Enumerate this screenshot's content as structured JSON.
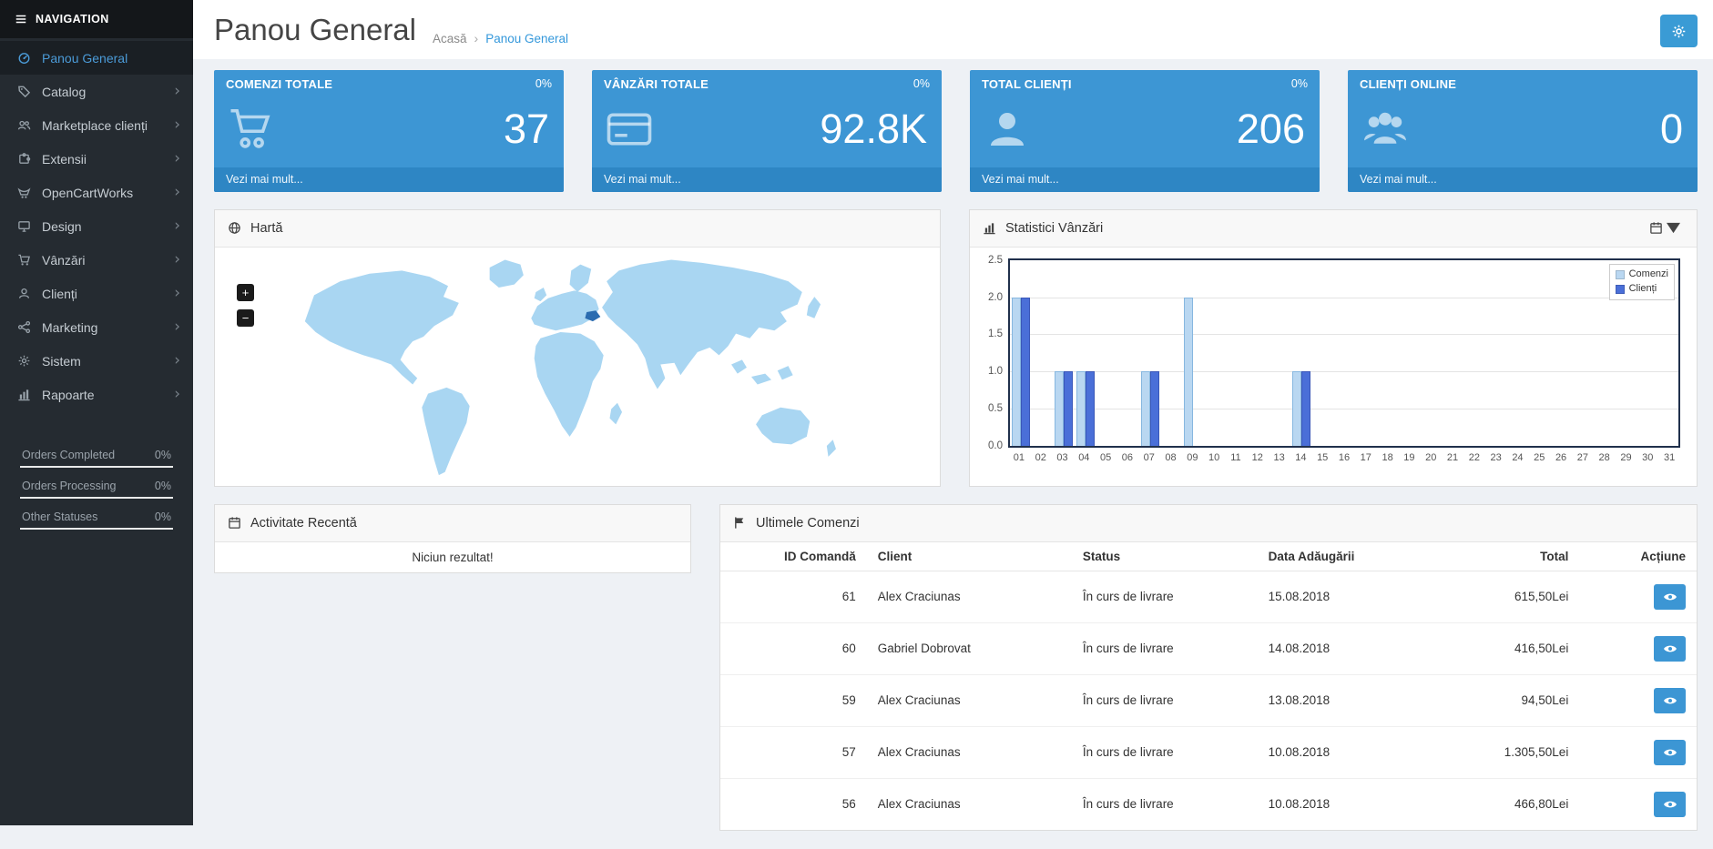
{
  "sidebar": {
    "nav_header": "NAVIGATION",
    "items": [
      {
        "label": "Panou General",
        "icon": "dashboard-icon",
        "active": true,
        "has_children": false
      },
      {
        "label": "Catalog",
        "icon": "tags-icon",
        "active": false,
        "has_children": true
      },
      {
        "label": "Marketplace clienți",
        "icon": "users-icon",
        "active": false,
        "has_children": true
      },
      {
        "label": "Extensii",
        "icon": "puzzle-icon",
        "active": false,
        "has_children": true
      },
      {
        "label": "OpenCartWorks",
        "icon": "opencart-icon",
        "active": false,
        "has_children": true
      },
      {
        "label": "Design",
        "icon": "monitor-icon",
        "active": false,
        "has_children": true
      },
      {
        "label": "Vânzări",
        "icon": "cart-icon",
        "active": false,
        "has_children": true
      },
      {
        "label": "Clienți",
        "icon": "user-icon",
        "active": false,
        "has_children": true
      },
      {
        "label": "Marketing",
        "icon": "share-icon",
        "active": false,
        "has_children": true
      },
      {
        "label": "Sistem",
        "icon": "gear-icon",
        "active": false,
        "has_children": true
      },
      {
        "label": "Rapoarte",
        "icon": "bar-chart-icon",
        "active": false,
        "has_children": true
      }
    ],
    "stats": [
      {
        "label": "Orders Completed",
        "value": "0%"
      },
      {
        "label": "Orders Processing",
        "value": "0%"
      },
      {
        "label": "Other Statuses",
        "value": "0%"
      }
    ]
  },
  "header": {
    "title": "Panou General",
    "breadcrumb": [
      "Acasă",
      "Panou General"
    ]
  },
  "tiles": [
    {
      "title": "COMENZI TOTALE",
      "percent": "0%",
      "value": "37",
      "icon": "shopping-cart-icon",
      "link": "Vezi mai mult..."
    },
    {
      "title": "VÂNZĂRI TOTALE",
      "percent": "0%",
      "value": "92.8K",
      "icon": "credit-card-icon",
      "link": "Vezi mai mult..."
    },
    {
      "title": "TOTAL CLIENȚI",
      "percent": "0%",
      "value": "206",
      "icon": "person-icon",
      "link": "Vezi mai mult..."
    },
    {
      "title": "CLIENȚI ONLINE",
      "percent": "",
      "value": "0",
      "icon": "people-icon",
      "link": "Vezi mai mult..."
    }
  ],
  "map_panel": {
    "title": "Hartă",
    "zoom_in": "+",
    "zoom_out": "−"
  },
  "chart_panel": {
    "title": "Statistici Vânzări"
  },
  "chart_data": {
    "type": "bar",
    "title": "Statistici Vânzări",
    "x": [
      "01",
      "02",
      "03",
      "04",
      "05",
      "06",
      "07",
      "08",
      "09",
      "10",
      "11",
      "12",
      "13",
      "14",
      "15",
      "16",
      "17",
      "18",
      "19",
      "20",
      "21",
      "22",
      "23",
      "24",
      "25",
      "26",
      "27",
      "28",
      "29",
      "30",
      "31"
    ],
    "series": [
      {
        "name": "Comenzi",
        "color": "#b9d7f1",
        "border": "#86b7e0",
        "values": [
          2,
          0,
          1,
          1,
          0,
          0,
          1,
          0,
          2,
          0,
          0,
          0,
          0,
          1,
          0,
          0,
          0,
          0,
          0,
          0,
          0,
          0,
          0,
          0,
          0,
          0,
          0,
          0,
          0,
          0,
          0
        ]
      },
      {
        "name": "Clienți",
        "color": "#4a6fd8",
        "border": "#3a57b8",
        "values": [
          2,
          0,
          1,
          1,
          0,
          0,
          1,
          0,
          0,
          0,
          0,
          0,
          0,
          1,
          0,
          0,
          0,
          0,
          0,
          0,
          0,
          0,
          0,
          0,
          0,
          0,
          0,
          0,
          0,
          0,
          0
        ]
      }
    ],
    "ylim": [
      0,
      2.5
    ],
    "yticks": [
      0.0,
      0.5,
      1.0,
      1.5,
      2.0,
      2.5
    ],
    "grid": true,
    "legend_position": "top-right"
  },
  "activity_panel": {
    "title": "Activitate Recentă",
    "empty_text": "Niciun rezultat!"
  },
  "orders_panel": {
    "title": "Ultimele Comenzi",
    "columns": [
      "ID Comandă",
      "Client",
      "Status",
      "Data Adăugării",
      "Total",
      "Acțiune"
    ],
    "rows": [
      {
        "id": "61",
        "client": "Alex Craciunas",
        "status": "În curs de livrare",
        "date": "15.08.2018",
        "total": "615,50Lei"
      },
      {
        "id": "60",
        "client": "Gabriel Dobrovat",
        "status": "În curs de livrare",
        "date": "14.08.2018",
        "total": "416,50Lei"
      },
      {
        "id": "59",
        "client": "Alex Craciunas",
        "status": "În curs de livrare",
        "date": "13.08.2018",
        "total": "94,50Lei"
      },
      {
        "id": "57",
        "client": "Alex Craciunas",
        "status": "În curs de livrare",
        "date": "10.08.2018",
        "total": "1.305,50Lei"
      },
      {
        "id": "56",
        "client": "Alex Craciunas",
        "status": "În curs de livrare",
        "date": "10.08.2018",
        "total": "466,80Lei"
      }
    ]
  },
  "colors": {
    "accent": "#3498db",
    "tile_bg": "#3d96d4",
    "tile_footer": "#2e86c4",
    "sidebar_bg": "#252b31",
    "sidebar_header_bg": "#14171a",
    "sidebar_active_text": "#4b9bd8",
    "map_land": "#a9d6f2",
    "map_highlight": "#2b6cb0",
    "chart_border": "#20304c"
  }
}
